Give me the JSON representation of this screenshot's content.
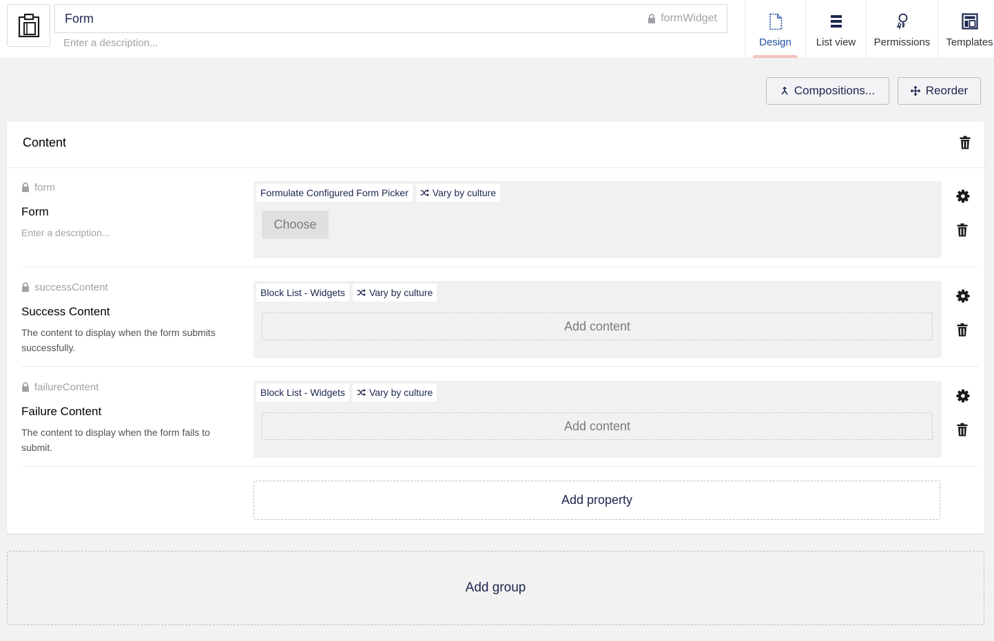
{
  "header": {
    "name_value": "Form",
    "alias": "formWidget",
    "description_placeholder": "Enter a description..."
  },
  "apps": [
    {
      "label": "Design",
      "icon": "document-icon",
      "active": true
    },
    {
      "label": "List view",
      "icon": "list-icon"
    },
    {
      "label": "Permissions",
      "icon": "permissions-icon"
    },
    {
      "label": "Templates",
      "icon": "templates-icon"
    }
  ],
  "toolbar": {
    "compositions_label": "Compositions...",
    "reorder_label": "Reorder"
  },
  "group": {
    "title": "Content",
    "properties": [
      {
        "alias": "form",
        "name": "Form",
        "description": "Enter a description...",
        "description_is_placeholder": true,
        "editor": "Formulate Configured Form Picker",
        "variation": "Vary by culture",
        "action_label": "Choose",
        "action_type": "choose"
      },
      {
        "alias": "successContent",
        "name": "Success Content",
        "description": "The content to display when the form submits successfully.",
        "editor": "Block List - Widgets",
        "variation": "Vary by culture",
        "action_label": "Add content",
        "action_type": "add"
      },
      {
        "alias": "failureContent",
        "name": "Failure Content",
        "description": "The content to display when the form fails to submit.",
        "editor": "Block List - Widgets",
        "variation": "Vary by culture",
        "action_label": "Add content",
        "action_type": "add"
      }
    ],
    "add_property_label": "Add property"
  },
  "add_group_label": "Add group",
  "colors": {
    "accent": "#2152a3",
    "active_indicator": "#f5c1bc",
    "text": "#1b264f",
    "background": "#f3f2f2"
  }
}
